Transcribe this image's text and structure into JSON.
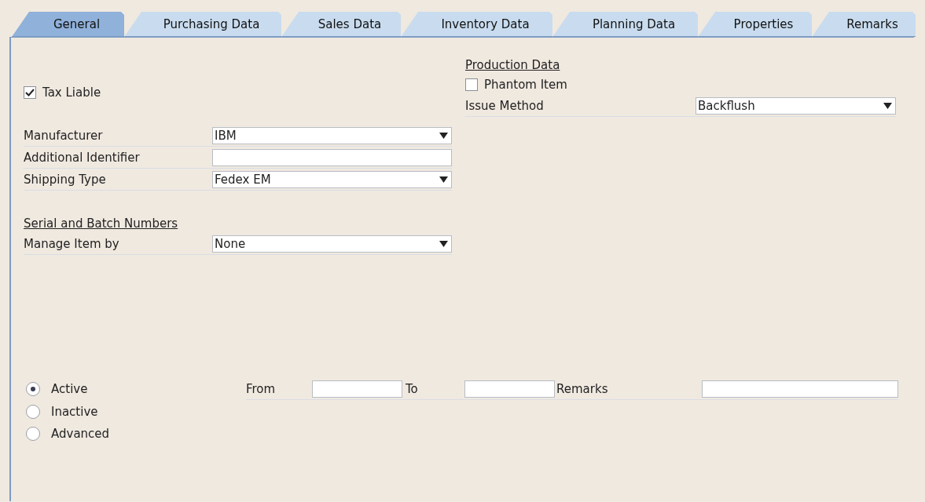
{
  "tabs": [
    {
      "label": "General",
      "selected": true
    },
    {
      "label": "Purchasing Data",
      "selected": false
    },
    {
      "label": "Sales Data",
      "selected": false
    },
    {
      "label": "Inventory Data",
      "selected": false
    },
    {
      "label": "Planning Data",
      "selected": false
    },
    {
      "label": "Properties",
      "selected": false
    },
    {
      "label": "Remarks",
      "selected": false
    }
  ],
  "tax_liable": {
    "label": "Tax Liable",
    "checked": true
  },
  "fields": [
    {
      "label": "Manufacturer",
      "kind": "dropdown",
      "value": "IBM"
    },
    {
      "label": "Additional Identifier",
      "kind": "text"
    },
    {
      "label": "Shipping Type",
      "kind": "dropdown",
      "value": "Fedex EM"
    }
  ],
  "serial_batch": {
    "heading": "Serial and Batch Numbers",
    "fields": [
      {
        "label": "Manage Item by",
        "kind": "dropdown",
        "value": "None"
      }
    ]
  },
  "production": {
    "heading": "Production Data",
    "phantom": {
      "label": "Phantom Item",
      "checked": false
    },
    "fields": [
      {
        "label": "Issue Method",
        "kind": "dropdown",
        "value": "Backflush"
      }
    ]
  },
  "status": {
    "options": [
      {
        "label": "Active",
        "selected": true
      },
      {
        "label": "Inactive",
        "selected": false
      },
      {
        "label": "Advanced",
        "selected": false
      }
    ],
    "from": {
      "label": "From"
    },
    "to": {
      "label": "To"
    },
    "remarks": {
      "label": "Remarks"
    }
  }
}
